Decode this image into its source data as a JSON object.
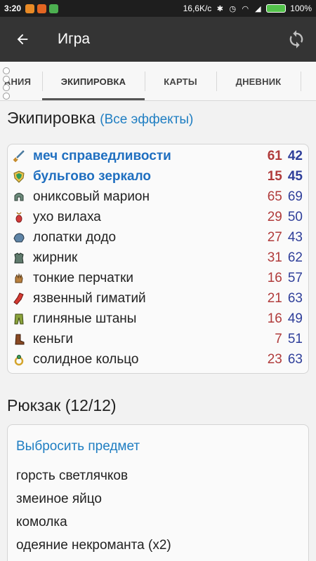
{
  "status_bar": {
    "time": "3:20",
    "network_speed": "16,6K/c",
    "battery": "100%",
    "colors": {
      "notif1": "#e88a26",
      "notif2": "#e26522",
      "notif3": "#4caf50"
    }
  },
  "app_bar": {
    "title": "Игра",
    "back_icon": "arrow-left-icon",
    "refresh_icon": "refresh-icon"
  },
  "tabs": [
    {
      "label": "АНИЯ"
    },
    {
      "label": "ЭКИПИРОВКА",
      "selected": true
    },
    {
      "label": "КАРТЫ"
    },
    {
      "label": "ДНЕВНИК"
    }
  ],
  "equipment": {
    "title": "Экипировка",
    "effects_link": "(Все эффекты)",
    "items": [
      {
        "name": "меч справедливости",
        "v1": "61",
        "v2": "42",
        "bold": true,
        "icon": "sword-icon"
      },
      {
        "name": "бульгово зеркало",
        "v1": "15",
        "v2": "45",
        "bold": true,
        "icon": "shield-icon"
      },
      {
        "name": "ониксовый марион",
        "v1": "65",
        "v2": "69",
        "icon": "helmet-icon"
      },
      {
        "name": "ухо вилаха",
        "v1": "29",
        "v2": "50",
        "icon": "amulet-icon"
      },
      {
        "name": "лопатки додо",
        "v1": "27",
        "v2": "43",
        "icon": "shoulder-icon"
      },
      {
        "name": "жирник",
        "v1": "31",
        "v2": "62",
        "icon": "armor-icon"
      },
      {
        "name": "тонкие перчатки",
        "v1": "16",
        "v2": "57",
        "icon": "gloves-icon"
      },
      {
        "name": "язвенный гиматий",
        "v1": "21",
        "v2": "63",
        "icon": "cloak-icon"
      },
      {
        "name": "глиняные штаны",
        "v1": "16",
        "v2": "49",
        "icon": "pants-icon"
      },
      {
        "name": "кеньги",
        "v1": "7",
        "v2": "51",
        "icon": "boots-icon"
      },
      {
        "name": "солидное кольцо",
        "v1": "23",
        "v2": "63",
        "icon": "ring-icon"
      }
    ]
  },
  "backpack": {
    "title": "Рюкзак (12/12)",
    "drop_link": "Выбросить предмет",
    "items": [
      "горсть светлячков",
      "змеиное яйцо",
      "комолка",
      "одеяние некроманта (x2)"
    ]
  }
}
